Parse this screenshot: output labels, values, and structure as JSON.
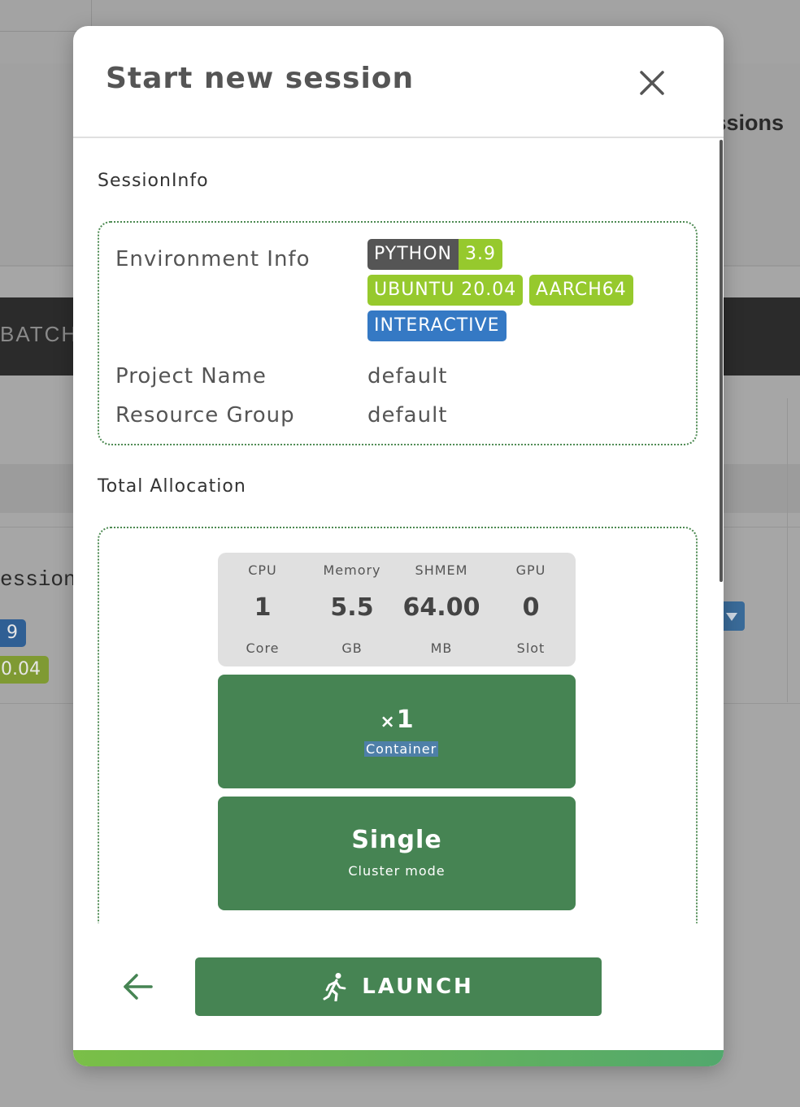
{
  "background": {
    "page_title_fragment": "ssions",
    "tab_fragment": "BATCH",
    "session_name_fragment": "ession",
    "tag_fragment_1": "9",
    "tag_fragment_2": "0.04"
  },
  "modal": {
    "title": "Start new session",
    "session_info": {
      "heading": "SessionInfo",
      "environment_label": "Environment Info",
      "tags": {
        "python_key": "PYTHON",
        "python_value": "3.9",
        "os": "UBUNTU 20.04",
        "arch": "AARCH64",
        "mode": "INTERACTIVE"
      },
      "project_label": "Project Name",
      "project_value": "default",
      "resource_group_label": "Resource Group",
      "resource_group_value": "default"
    },
    "allocation": {
      "heading": "Total Allocation",
      "resources": [
        {
          "name": "CPU",
          "value": "1",
          "unit": "Core"
        },
        {
          "name": "Memory",
          "value": "5.5",
          "unit": "GB"
        },
        {
          "name": "SHMEM",
          "value": "64.00",
          "unit": "MB"
        },
        {
          "name": "GPU",
          "value": "0",
          "unit": "Slot"
        }
      ],
      "container_multiplier": "×",
      "container_count": "1",
      "container_label": "Container",
      "cluster_value": "Single",
      "cluster_label": "Cluster mode"
    },
    "footer": {
      "launch_label": "LAUNCH",
      "back_icon": "arrow-left-icon",
      "launch_icon": "running-person-icon"
    }
  },
  "colors": {
    "accent_green": "#468453",
    "tag_green": "#96c92d",
    "tag_blue": "#3579c4",
    "tag_dark": "#555555"
  }
}
